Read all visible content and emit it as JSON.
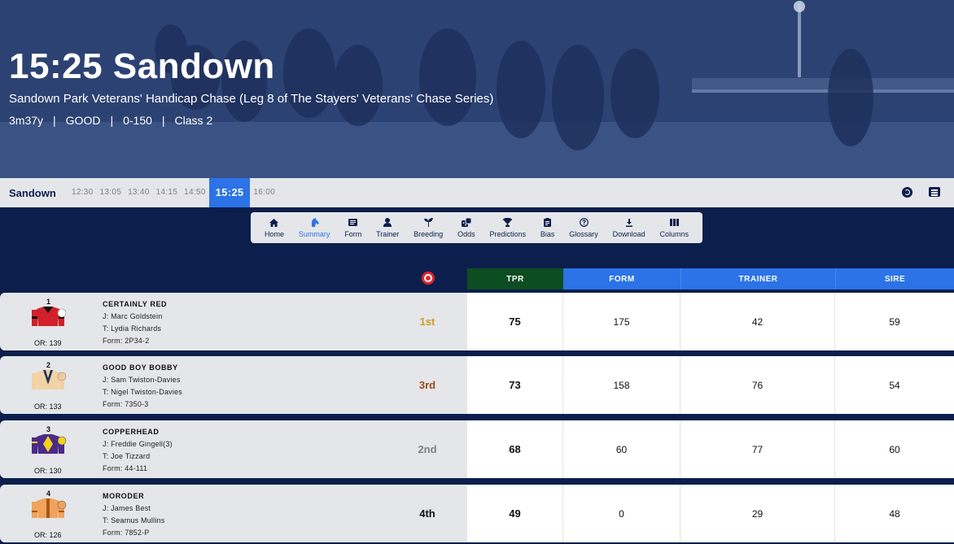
{
  "race": {
    "title": "15:25 Sandown",
    "subtitle": "Sandown Park Veterans' Handicap Chase (Leg 8 of The Stayers' Veterans' Chase Series)",
    "meta": [
      "3m37y",
      "GOOD",
      "0-150",
      "Class 2"
    ]
  },
  "timebar": {
    "venue": "Sandown",
    "times": [
      "12:30",
      "13:05",
      "13:40",
      "14:15",
      "14:50",
      "15:25",
      "16:00"
    ],
    "active": "15:25"
  },
  "nav": {
    "items": [
      {
        "label": "Home",
        "icon": "home-icon"
      },
      {
        "label": "Summary",
        "icon": "horse-head-icon",
        "active": true
      },
      {
        "label": "Form",
        "icon": "form-card-icon"
      },
      {
        "label": "Trainer",
        "icon": "person-icon"
      },
      {
        "label": "Breeding",
        "icon": "sprout-icon"
      },
      {
        "label": "Odds",
        "icon": "dice-icon"
      },
      {
        "label": "Predictions",
        "icon": "trophy-icon"
      },
      {
        "label": "Bias",
        "icon": "clipboard-icon"
      },
      {
        "label": "Glossary",
        "icon": "question-icon"
      },
      {
        "label": "Download",
        "icon": "download-icon"
      },
      {
        "label": "Columns",
        "icon": "columns-icon"
      }
    ]
  },
  "table": {
    "headers": {
      "tpr": "TPR",
      "form": "FORM",
      "trainer": "TRAINER",
      "sire": "SIRE"
    },
    "colors": {
      "tpr_header": "#0d4d22",
      "header": "#2b73e7",
      "pos_1st": "#d59a22",
      "pos_2nd": "#7d8187",
      "pos_3rd": "#a0461c",
      "pos_4th": "#111111"
    },
    "rows": [
      {
        "num": "1",
        "name": "CERTAINLY RED",
        "jockey": "J: Marc Goldstein",
        "trainer": "T: Lydia Richards",
        "form": "Form: 2P34-2",
        "or": "OR: 139",
        "pos": "1st",
        "pos_key": "pos_1st",
        "tpr": "75",
        "form_score": "175",
        "trainer_score": "42",
        "sire_score": "59",
        "silk": "red"
      },
      {
        "num": "2",
        "name": "GOOD BOY BOBBY",
        "jockey": "J: Sam Twiston-Davies",
        "trainer": "T: Nigel Twiston-Davies",
        "form": "Form: 7350-3",
        "or": "OR: 133",
        "pos": "3rd",
        "pos_key": "pos_3rd",
        "tpr": "73",
        "form_score": "158",
        "trainer_score": "76",
        "sire_score": "54",
        "silk": "cream-blue"
      },
      {
        "num": "3",
        "name": "COPPERHEAD",
        "jockey": "J: Freddie Gingell(3)",
        "trainer": "T: Joe Tizzard",
        "form": "Form: 44-111",
        "or": "OR: 130",
        "pos": "2nd",
        "pos_key": "pos_2nd",
        "tpr": "68",
        "form_score": "60",
        "trainer_score": "77",
        "sire_score": "60",
        "silk": "purple-yellow"
      },
      {
        "num": "4",
        "name": "MORODER",
        "jockey": "J: James Best",
        "trainer": "T: Seamus Mullins",
        "form": "Form: 7852-P",
        "or": "OR: 126",
        "pos": "4th",
        "pos_key": "pos_4th",
        "tpr": "49",
        "form_score": "0",
        "trainer_score": "29",
        "sire_score": "48",
        "silk": "orange"
      }
    ]
  }
}
